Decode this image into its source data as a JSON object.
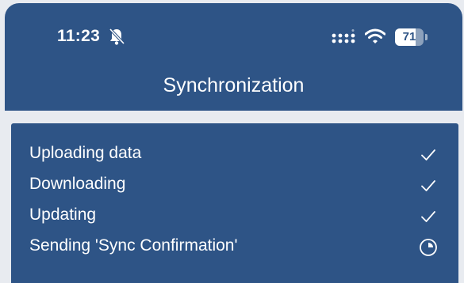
{
  "status_bar": {
    "time": "11:23",
    "battery_level": "71",
    "battery_fraction": 0.71,
    "icons": [
      "bell-slash-icon",
      "cellular-signal-icon",
      "wifi-icon",
      "battery-icon"
    ]
  },
  "header": {
    "title": "Synchronization"
  },
  "sync_steps": [
    {
      "label": "Uploading data",
      "status": "done",
      "icon": "checkmark-icon"
    },
    {
      "label": "Downloading",
      "status": "done",
      "icon": "checkmark-icon"
    },
    {
      "label": "Updating",
      "status": "done",
      "icon": "checkmark-icon"
    },
    {
      "label": "Sending 'Sync Confirmation'",
      "status": "in-progress",
      "icon": "clock-progress-icon"
    }
  ],
  "colors": {
    "header_bg": "#2e5486",
    "card_bg": "#2e5486",
    "page_bg": "#e8ebf0",
    "text": "#ffffff"
  }
}
